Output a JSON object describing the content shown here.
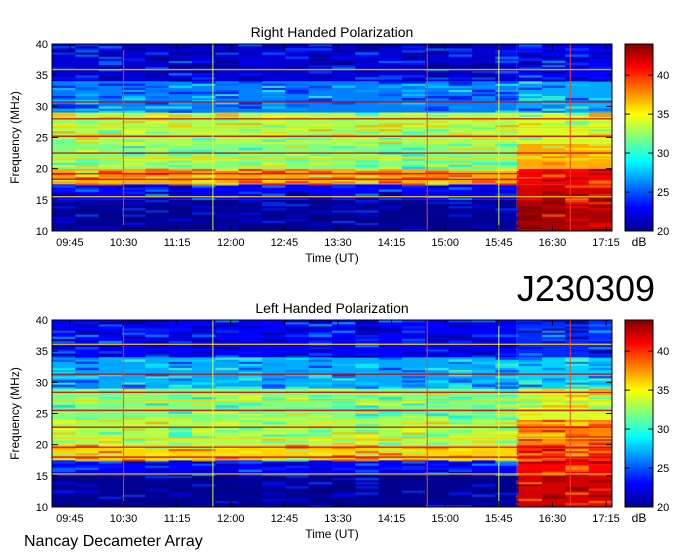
{
  "figure": {
    "id_label": "J230309",
    "footer": "Nancay Decameter Array"
  },
  "chart_data": [
    {
      "type": "heatmap",
      "title": "Right Handed Polarization",
      "xlabel": "Time (UT)",
      "ylabel": "Frequency (MHz)",
      "xticks": [
        "09:45",
        "10:30",
        "11:15",
        "12:00",
        "12:45",
        "13:30",
        "14:15",
        "15:00",
        "15:45",
        "16:30",
        "17:15"
      ],
      "xlim": [
        "09:30",
        "17:20"
      ],
      "ylim": [
        10,
        40
      ],
      "yticks": [
        10,
        15,
        20,
        25,
        30,
        35,
        40
      ],
      "colorbar": {
        "label": "dB",
        "range": [
          20,
          44
        ],
        "ticks": [
          20,
          25,
          30,
          35,
          40
        ]
      },
      "colormap": "jet",
      "bands": [
        {
          "f_low": 10,
          "f_high": 15,
          "db": 20.5,
          "db_after_1600": 43
        },
        {
          "f_low": 15,
          "f_high": 17.5,
          "db": 23,
          "db_after_1600": 42
        },
        {
          "f_low": 17.5,
          "f_high": 20,
          "db": 37,
          "db_after_1600": 41
        },
        {
          "f_low": 20,
          "f_high": 24,
          "db": 32,
          "db_after_1600": 37
        },
        {
          "f_low": 24,
          "f_high": 29,
          "db": 33,
          "db_after_1600": 34
        },
        {
          "f_low": 29,
          "f_high": 34,
          "db": 26,
          "db_after_1600": 27
        },
        {
          "f_low": 34,
          "f_high": 40,
          "db": 22,
          "db_after_1600": 23
        }
      ],
      "rfi_lines_mhz": [
        15.5,
        18.3,
        19.2,
        21.6,
        22.5,
        25.2,
        26.6,
        28.0,
        30.7,
        35.9
      ],
      "time_markers": [
        "10:30",
        "11:45",
        "14:45",
        "15:45",
        "16:45"
      ]
    },
    {
      "type": "heatmap",
      "title": "Left Handed Polarization",
      "xlabel": "Time (UT)",
      "ylabel": "Frequency (MHz)",
      "xticks": [
        "09:45",
        "10:30",
        "11:15",
        "12:00",
        "12:45",
        "13:30",
        "14:15",
        "15:00",
        "15:45",
        "16:30",
        "17:15"
      ],
      "xlim": [
        "09:30",
        "17:20"
      ],
      "ylim": [
        10,
        40
      ],
      "yticks": [
        10,
        15,
        20,
        25,
        30,
        35,
        40
      ],
      "colorbar": {
        "label": "dB",
        "range": [
          20,
          44
        ],
        "ticks": [
          20,
          25,
          30,
          35,
          40
        ]
      },
      "colormap": "jet",
      "bands": [
        {
          "f_low": 10,
          "f_high": 15,
          "db": 20.5,
          "db_after_1600": 42
        },
        {
          "f_low": 15,
          "f_high": 17.5,
          "db": 23,
          "db_after_1600": 41
        },
        {
          "f_low": 17.5,
          "f_high": 20,
          "db": 36,
          "db_after_1600": 40
        },
        {
          "f_low": 20,
          "f_high": 24,
          "db": 33,
          "db_after_1600": 38
        },
        {
          "f_low": 24,
          "f_high": 29,
          "db": 32,
          "db_after_1600": 34
        },
        {
          "f_low": 29,
          "f_high": 34,
          "db": 27,
          "db_after_1600": 28
        },
        {
          "f_low": 34,
          "f_high": 40,
          "db": 23,
          "db_after_1600": 24
        }
      ],
      "rfi_lines_mhz": [
        15.3,
        18.0,
        19.6,
        21.0,
        22.8,
        25.5,
        27.0,
        28.4,
        31.3,
        36.1
      ],
      "time_markers": [
        "10:30",
        "11:45",
        "14:45",
        "15:45",
        "16:45"
      ]
    }
  ]
}
